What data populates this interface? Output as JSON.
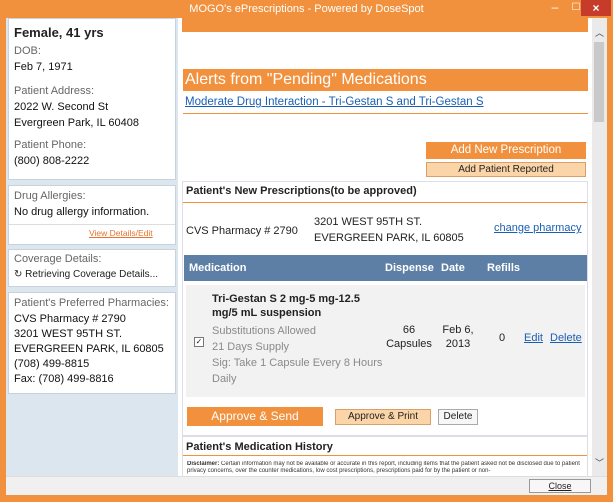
{
  "window": {
    "title": "MOGO's ePrescriptions - Powered by DoseSpot"
  },
  "patient": {
    "name_line": "Female, 41 yrs",
    "dob_label": "DOB:",
    "dob": "Feb 7, 1971",
    "address_label": "Patient Address:",
    "address1": "2022 W. Second St",
    "address2": "Evergreen Park, IL 60408",
    "phone_label": "Patient Phone:",
    "phone": "(800) 808-2222"
  },
  "allergies": {
    "label": "Drug Allergies:",
    "value": "No drug allergy information.",
    "link": "View Details/Edit"
  },
  "coverage": {
    "label": "Coverage Details:",
    "status_icon": "spinner-icon",
    "status": "Retrieving Coverage Details..."
  },
  "preferred": {
    "label": "Patient's Preferred Pharmacies:",
    "line1": "CVS Pharmacy # 2790",
    "line2": "3201 WEST 95TH ST.",
    "line3": "EVERGREEN PARK, IL 60805",
    "line4": "(708) 499-8815",
    "line5": "Fax: (708) 499-8816"
  },
  "alerts": {
    "heading": "Alerts from \"Pending\" Medications",
    "link": "Moderate Drug Interaction - Tri-Gestan S and Tri-Gestan S"
  },
  "actions": {
    "add_new": "Add New Prescription",
    "add_reported": "Add Patient Reported"
  },
  "new_rx": {
    "heading": "Patient's New Prescriptions(to be approved)",
    "pharmacy_name": "CVS Pharmacy # 2790",
    "pharmacy_addr1": "3201 WEST 95TH ST.",
    "pharmacy_addr2": "EVERGREEN PARK, IL 60805",
    "change_link": "change pharmacy",
    "columns": {
      "medication": "Medication",
      "dispense": "Dispense",
      "date": "Date",
      "refills": "Refills"
    },
    "row": {
      "name1": "Tri-Gestan S 2 mg-5 mg-12.5",
      "name2": "mg/5 mL suspension",
      "detail1": "Substitutions Allowed",
      "detail2": "21 Days Supply",
      "detail3": "Sig: Take 1 Capsule Every 8 Hours",
      "detail4": "Daily",
      "dispense1": "66",
      "dispense2": "Capsules",
      "date1": "Feb 6,",
      "date2": "2013",
      "refills": "0",
      "edit": "Edit",
      "delete": "Delete"
    },
    "approve_send": "Approve & Send",
    "approve_print": "Approve & Print",
    "delete": "Delete"
  },
  "history": {
    "heading": "Patient's Medication History",
    "disclaimer_label": "Disclaimer:",
    "disclaimer": "Certain information may not be available or accurate in this report, including items that the patient asked not be disclosed due to patient privacy concerns, over the counter medications, low cost prescriptions, prescriptions paid for by the patient or non-"
  },
  "footer": {
    "close": "Close"
  }
}
